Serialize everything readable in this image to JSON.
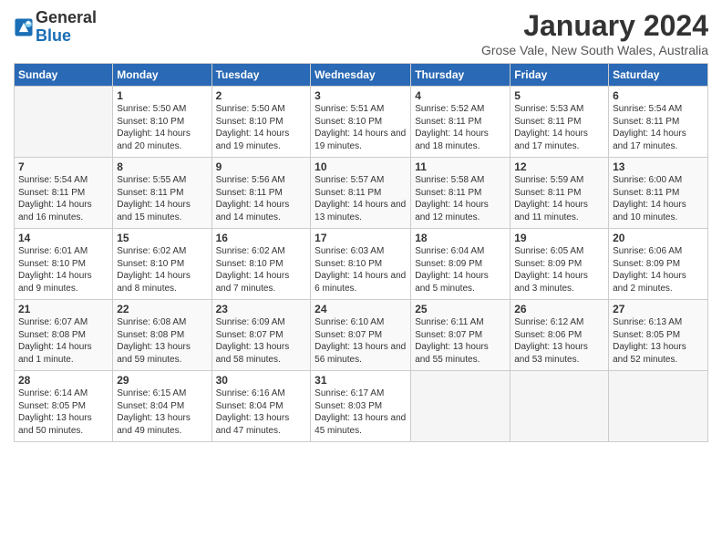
{
  "header": {
    "logo_line1": "General",
    "logo_line2": "Blue",
    "month": "January 2024",
    "location": "Grose Vale, New South Wales, Australia"
  },
  "weekdays": [
    "Sunday",
    "Monday",
    "Tuesday",
    "Wednesday",
    "Thursday",
    "Friday",
    "Saturday"
  ],
  "weeks": [
    [
      {
        "num": "",
        "info": ""
      },
      {
        "num": "1",
        "info": "Sunrise: 5:50 AM\nSunset: 8:10 PM\nDaylight: 14 hours\nand 20 minutes."
      },
      {
        "num": "2",
        "info": "Sunrise: 5:50 AM\nSunset: 8:10 PM\nDaylight: 14 hours\nand 19 minutes."
      },
      {
        "num": "3",
        "info": "Sunrise: 5:51 AM\nSunset: 8:10 PM\nDaylight: 14 hours\nand 19 minutes."
      },
      {
        "num": "4",
        "info": "Sunrise: 5:52 AM\nSunset: 8:11 PM\nDaylight: 14 hours\nand 18 minutes."
      },
      {
        "num": "5",
        "info": "Sunrise: 5:53 AM\nSunset: 8:11 PM\nDaylight: 14 hours\nand 17 minutes."
      },
      {
        "num": "6",
        "info": "Sunrise: 5:54 AM\nSunset: 8:11 PM\nDaylight: 14 hours\nand 17 minutes."
      }
    ],
    [
      {
        "num": "7",
        "info": "Sunrise: 5:54 AM\nSunset: 8:11 PM\nDaylight: 14 hours\nand 16 minutes."
      },
      {
        "num": "8",
        "info": "Sunrise: 5:55 AM\nSunset: 8:11 PM\nDaylight: 14 hours\nand 15 minutes."
      },
      {
        "num": "9",
        "info": "Sunrise: 5:56 AM\nSunset: 8:11 PM\nDaylight: 14 hours\nand 14 minutes."
      },
      {
        "num": "10",
        "info": "Sunrise: 5:57 AM\nSunset: 8:11 PM\nDaylight: 14 hours\nand 13 minutes."
      },
      {
        "num": "11",
        "info": "Sunrise: 5:58 AM\nSunset: 8:11 PM\nDaylight: 14 hours\nand 12 minutes."
      },
      {
        "num": "12",
        "info": "Sunrise: 5:59 AM\nSunset: 8:11 PM\nDaylight: 14 hours\nand 11 minutes."
      },
      {
        "num": "13",
        "info": "Sunrise: 6:00 AM\nSunset: 8:11 PM\nDaylight: 14 hours\nand 10 minutes."
      }
    ],
    [
      {
        "num": "14",
        "info": "Sunrise: 6:01 AM\nSunset: 8:10 PM\nDaylight: 14 hours\nand 9 minutes."
      },
      {
        "num": "15",
        "info": "Sunrise: 6:02 AM\nSunset: 8:10 PM\nDaylight: 14 hours\nand 8 minutes."
      },
      {
        "num": "16",
        "info": "Sunrise: 6:02 AM\nSunset: 8:10 PM\nDaylight: 14 hours\nand 7 minutes."
      },
      {
        "num": "17",
        "info": "Sunrise: 6:03 AM\nSunset: 8:10 PM\nDaylight: 14 hours\nand 6 minutes."
      },
      {
        "num": "18",
        "info": "Sunrise: 6:04 AM\nSunset: 8:09 PM\nDaylight: 14 hours\nand 5 minutes."
      },
      {
        "num": "19",
        "info": "Sunrise: 6:05 AM\nSunset: 8:09 PM\nDaylight: 14 hours\nand 3 minutes."
      },
      {
        "num": "20",
        "info": "Sunrise: 6:06 AM\nSunset: 8:09 PM\nDaylight: 14 hours\nand 2 minutes."
      }
    ],
    [
      {
        "num": "21",
        "info": "Sunrise: 6:07 AM\nSunset: 8:08 PM\nDaylight: 14 hours\nand 1 minute."
      },
      {
        "num": "22",
        "info": "Sunrise: 6:08 AM\nSunset: 8:08 PM\nDaylight: 13 hours\nand 59 minutes."
      },
      {
        "num": "23",
        "info": "Sunrise: 6:09 AM\nSunset: 8:07 PM\nDaylight: 13 hours\nand 58 minutes."
      },
      {
        "num": "24",
        "info": "Sunrise: 6:10 AM\nSunset: 8:07 PM\nDaylight: 13 hours\nand 56 minutes."
      },
      {
        "num": "25",
        "info": "Sunrise: 6:11 AM\nSunset: 8:07 PM\nDaylight: 13 hours\nand 55 minutes."
      },
      {
        "num": "26",
        "info": "Sunrise: 6:12 AM\nSunset: 8:06 PM\nDaylight: 13 hours\nand 53 minutes."
      },
      {
        "num": "27",
        "info": "Sunrise: 6:13 AM\nSunset: 8:05 PM\nDaylight: 13 hours\nand 52 minutes."
      }
    ],
    [
      {
        "num": "28",
        "info": "Sunrise: 6:14 AM\nSunset: 8:05 PM\nDaylight: 13 hours\nand 50 minutes."
      },
      {
        "num": "29",
        "info": "Sunrise: 6:15 AM\nSunset: 8:04 PM\nDaylight: 13 hours\nand 49 minutes."
      },
      {
        "num": "30",
        "info": "Sunrise: 6:16 AM\nSunset: 8:04 PM\nDaylight: 13 hours\nand 47 minutes."
      },
      {
        "num": "31",
        "info": "Sunrise: 6:17 AM\nSunset: 8:03 PM\nDaylight: 13 hours\nand 45 minutes."
      },
      {
        "num": "",
        "info": ""
      },
      {
        "num": "",
        "info": ""
      },
      {
        "num": "",
        "info": ""
      }
    ]
  ]
}
